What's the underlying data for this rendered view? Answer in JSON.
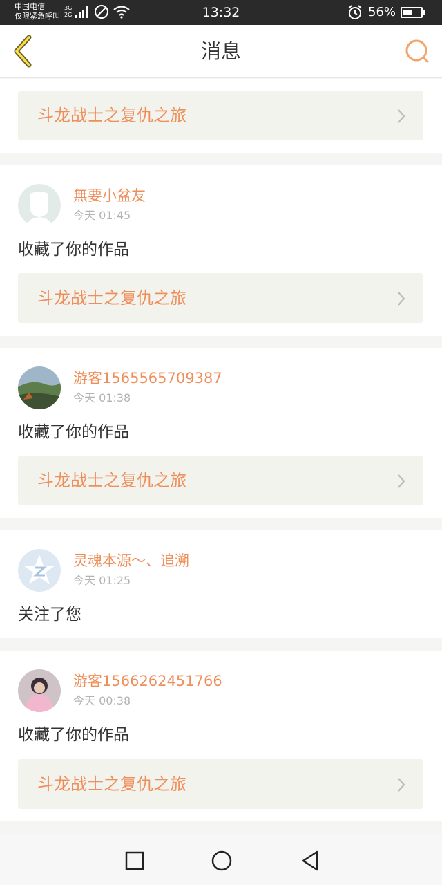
{
  "status_bar": {
    "carrier_line1": "中国电信",
    "carrier_line2": "仅限紧急呼叫",
    "network_top": "3G",
    "network_bottom": "2G",
    "time": "13:32",
    "battery_percent": "56%",
    "battery_level": 0.56,
    "icons": [
      "signal-icon",
      "do-not-disturb-icon",
      "wifi-icon",
      "alarm-icon",
      "battery-icon"
    ]
  },
  "header": {
    "title": "消息",
    "back_icon": "chevron-left-icon",
    "search_icon": "search-icon",
    "accent_color": "#f2a36b"
  },
  "top_item": {
    "work_title": "斗龙战士之复仇之旅"
  },
  "messages": [
    {
      "username": "無要小盆友",
      "time": "今天 01:45",
      "action": "收藏了你的作品",
      "work_title": "斗龙战士之复仇之旅"
    },
    {
      "username": "游客1565565709387",
      "time": "今天 01:38",
      "action": "收藏了你的作品",
      "work_title": "斗龙战士之复仇之旅"
    },
    {
      "username": "灵魂本源～、追溯",
      "time": "今天 01:25",
      "action": "关注了您"
    },
    {
      "username": "游客1566262451766",
      "time": "今天 00:38",
      "action": "收藏了你的作品",
      "work_title": "斗龙战士之复仇之旅"
    }
  ],
  "nav_bar": {
    "buttons": [
      "recent-apps-icon",
      "home-icon",
      "back-icon"
    ]
  },
  "colors": {
    "name_orange": "#ee8f5b",
    "card_bg": "#f3f3ee",
    "page_bg": "#f5f5f3"
  }
}
